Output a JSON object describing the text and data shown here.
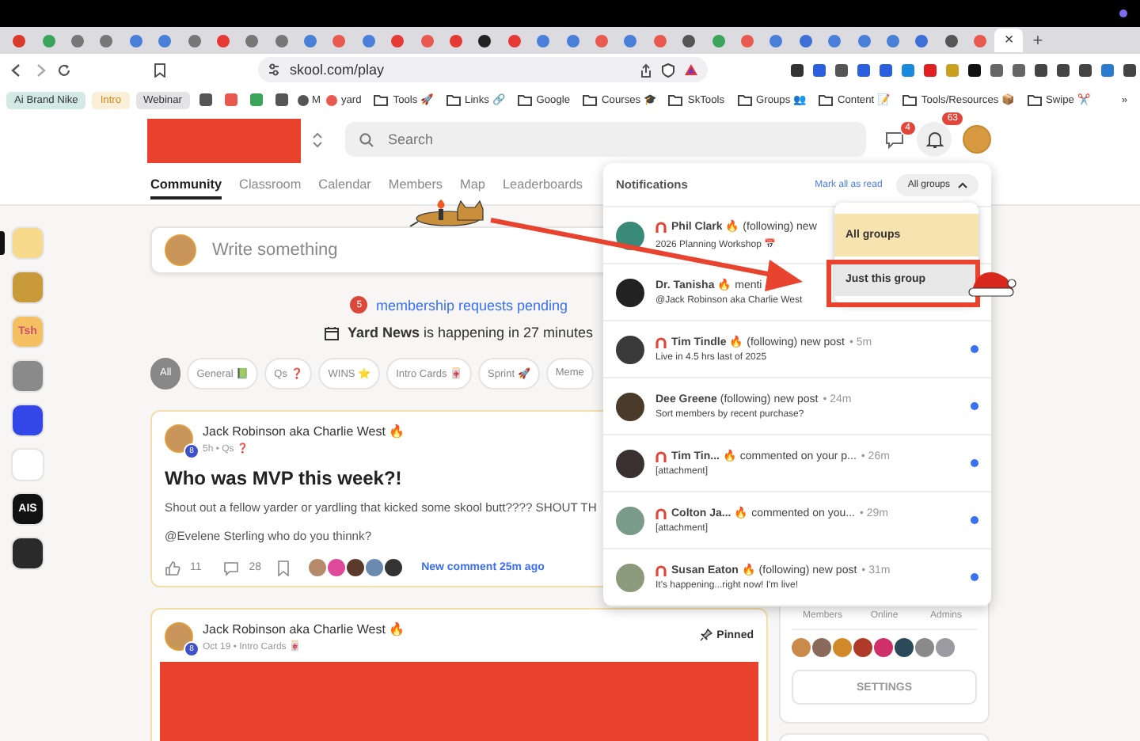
{
  "browser": {
    "tabs": [
      {
        "color": "#d93a2b",
        "selected": false
      },
      {
        "color": "#3aa55a",
        "selected": false
      },
      {
        "color": "#777777",
        "selected": false
      },
      {
        "color": "#777777",
        "selected": false
      },
      {
        "color": "#4a7fd8",
        "selected": false
      },
      {
        "color": "#4a7fd8",
        "selected": false
      },
      {
        "color": "#777777",
        "selected": false
      },
      {
        "color": "#e53935",
        "selected": false
      },
      {
        "color": "#777777",
        "selected": false
      },
      {
        "color": "#777777",
        "selected": false
      },
      {
        "color": "#4a7fd8",
        "selected": false
      },
      {
        "color": "#e85a4f",
        "selected": false
      },
      {
        "color": "#4a7fd8",
        "selected": false
      },
      {
        "color": "#e53935",
        "selected": false
      },
      {
        "color": "#e85a4f",
        "selected": false
      },
      {
        "color": "#e53935",
        "selected": false
      },
      {
        "color": "#222222",
        "selected": false
      },
      {
        "color": "#e53935",
        "selected": false
      },
      {
        "color": "#4a7fd8",
        "selected": false
      },
      {
        "color": "#4a7fd8",
        "selected": false
      },
      {
        "color": "#e85a4f",
        "selected": false
      },
      {
        "color": "#4a7fd8",
        "selected": false
      },
      {
        "color": "#e85a4f",
        "selected": false
      },
      {
        "color": "#555555",
        "selected": false
      },
      {
        "color": "#3aa55a",
        "selected": false
      },
      {
        "color": "#e85a4f",
        "selected": false
      },
      {
        "color": "#4a7fd8",
        "selected": false
      },
      {
        "color": "#3d6fd6",
        "selected": false
      },
      {
        "color": "#4a7fd8",
        "selected": false
      },
      {
        "color": "#4a7fd8",
        "selected": false
      },
      {
        "color": "#4a7fd8",
        "selected": false
      },
      {
        "color": "#3d6fd6",
        "selected": false
      },
      {
        "color": "#555555",
        "selected": false
      },
      {
        "color": "#e85a4f",
        "selected": false
      },
      {
        "selected": true,
        "close": "×"
      }
    ],
    "new_tab": "+",
    "url": "skool.com/play",
    "bookmarks": [
      {
        "kind": "chip",
        "label": "Ai Brand Nike",
        "color": "#d3e9e4"
      },
      {
        "kind": "chip",
        "label": "Intro",
        "color": "#fcefd9"
      },
      {
        "kind": "chip",
        "label": "Webinar",
        "color": "#e3e3e6"
      },
      {
        "kind": "icon",
        "color": "#555555"
      },
      {
        "kind": "icon",
        "color": "#e85a4f"
      },
      {
        "kind": "icon",
        "color": "#3aa55a"
      },
      {
        "kind": "icon",
        "color": "#555555"
      },
      {
        "kind": "link",
        "label": "M",
        "color": "#555555"
      },
      {
        "kind": "link",
        "label": "yard",
        "color": "#e85a4f"
      },
      {
        "kind": "folder",
        "label": "Tools 🚀"
      },
      {
        "kind": "folder",
        "label": "Links 🔗"
      },
      {
        "kind": "folder",
        "label": "Google"
      },
      {
        "kind": "folder",
        "label": "Courses 🎓"
      },
      {
        "kind": "folder",
        "label": "SkTools"
      },
      {
        "kind": "folder",
        "label": "Groups 👥"
      },
      {
        "kind": "folder",
        "label": "Content 📝"
      },
      {
        "kind": "folder",
        "label": "Tools/Resources 📦"
      },
      {
        "kind": "folder",
        "label": "Swipe ✂️"
      }
    ],
    "more": "»"
  },
  "header": {
    "search": {
      "placeholder": "Search"
    },
    "chat_badge": "4",
    "notification_badge": "63",
    "nav": [
      {
        "label": "Community",
        "selected": true
      },
      {
        "label": "Classroom",
        "selected": false
      },
      {
        "label": "Calendar",
        "selected": false
      },
      {
        "label": "Members",
        "selected": false
      },
      {
        "label": "Map",
        "selected": false
      },
      {
        "label": "Leaderboards",
        "selected": false
      }
    ]
  },
  "groups": [
    {
      "selected": true,
      "color": "#f6d98a"
    },
    {
      "selected": false,
      "color": "#c99a3a"
    },
    {
      "selected": false,
      "color": "#f4c062",
      "label": "Tsh"
    },
    {
      "selected": false,
      "color": "#8a8a8a"
    },
    {
      "selected": false,
      "color": "#3347e8"
    },
    {
      "selected": false,
      "color": "#ffffff"
    },
    {
      "selected": false,
      "color": "#111111",
      "label": "AIS"
    },
    {
      "selected": false,
      "color": "#2a2a2a"
    }
  ],
  "composer": {
    "placeholder": "Write something"
  },
  "pending": {
    "count": "5",
    "text": "membership requests pending"
  },
  "event": "**Yard News** is happening in 27 minutes",
  "filters": [
    {
      "label": "All",
      "selected": true
    },
    {
      "label": "General 📗",
      "selected": false
    },
    {
      "label": "Qs ❓",
      "selected": false
    },
    {
      "label": "WINS ⭐",
      "selected": false
    },
    {
      "label": "Intro Cards 🀄",
      "selected": false
    },
    {
      "label": "Sprint 🚀",
      "selected": false
    },
    {
      "label": "Meme",
      "selected": false
    }
  ],
  "posts": [
    {
      "author": "Jack Robinson aka Charlie West 🔥",
      "level": "8",
      "meta": "5h • Qs ❓",
      "title": "Who was MVP this week?!",
      "body": [
        "Shout out a fellow yarder or yardling that kicked some skool butt???? SHOUT TH",
        "@Evelene Sterling who do you thinnk?"
      ],
      "likes": "11",
      "comments": "28",
      "commenters": [
        {
          "color": "#b48a6a"
        },
        {
          "color": "#e04a9a"
        },
        {
          "color": "#5a3a2a"
        },
        {
          "color": "#6a8ab0"
        },
        {
          "color": "#333333"
        }
      ],
      "last_comment": "New comment 25m ago",
      "pinned": false
    },
    {
      "author": "Jack Robinson aka Charlie West 🔥",
      "level": "8",
      "meta": "Oct 19 • Intro Cards 🀄",
      "pinned": true,
      "pinned_label": "Pinned",
      "redacted_image": true
    }
  ],
  "about": {
    "stats": [
      "Members",
      "Online",
      "Admins"
    ],
    "members": [
      {
        "color": "#c98a4a"
      },
      {
        "color": "#8a6a5a"
      },
      {
        "color": "#d08a2a"
      },
      {
        "color": "#b03a2a"
      },
      {
        "color": "#d0306a"
      },
      {
        "color": "#2a4a5a"
      },
      {
        "color": "#8a8a8a"
      },
      {
        "color": "#9a9aa0"
      }
    ],
    "settings": "SETTINGS"
  },
  "notifications": {
    "title": "Notifications",
    "mark_all": "Mark all as read",
    "filter": "All groups",
    "items": [
      {
        "color": "#3a8a7a",
        "group_icon": true,
        "text": "**Phil Clark** 🔥 (following) new",
        "preview": "2026 Planning Workshop 📅",
        "unread": false
      },
      {
        "color": "#222222",
        "group_icon": false,
        "text": "**Dr. Tanisha** 🔥 menti",
        "preview": "@Jack Robinson aka Charlie West",
        "unread": false
      },
      {
        "color": "#3a3a3a",
        "group_icon": true,
        "text": "**Tim Tindle** 🔥 (following) new post",
        "time": "• 5m",
        "preview": "Live in 4.5 hrs last of 2025",
        "unread": true
      },
      {
        "color": "#4a3a2a",
        "group_icon": false,
        "text": "**Dee Greene** (following) new post",
        "time": "• 24m",
        "preview": "Sort members by recent purchase?",
        "unread": true
      },
      {
        "color": "#3a3030",
        "group_icon": true,
        "text": "**Tim Tin...** 🔥 commented on your p...",
        "time": "• 26m",
        "preview": "[attachment]",
        "unread": true
      },
      {
        "color": "#7a9a8a",
        "group_icon": true,
        "text": "**Colton Ja...** 🔥 commented on you...",
        "time": "• 29m",
        "preview": "[attachment]",
        "unread": true
      },
      {
        "color": "#8a9a7a",
        "group_icon": true,
        "text": "**Susan Eaton** 🔥 (following) new post",
        "time": "• 31m",
        "preview": "It's happening...right now! I'm live!",
        "unread": true
      }
    ],
    "dropdown": [
      {
        "label": "All groups",
        "selected": true
      },
      {
        "label": "Just this group",
        "selected": false
      }
    ]
  }
}
